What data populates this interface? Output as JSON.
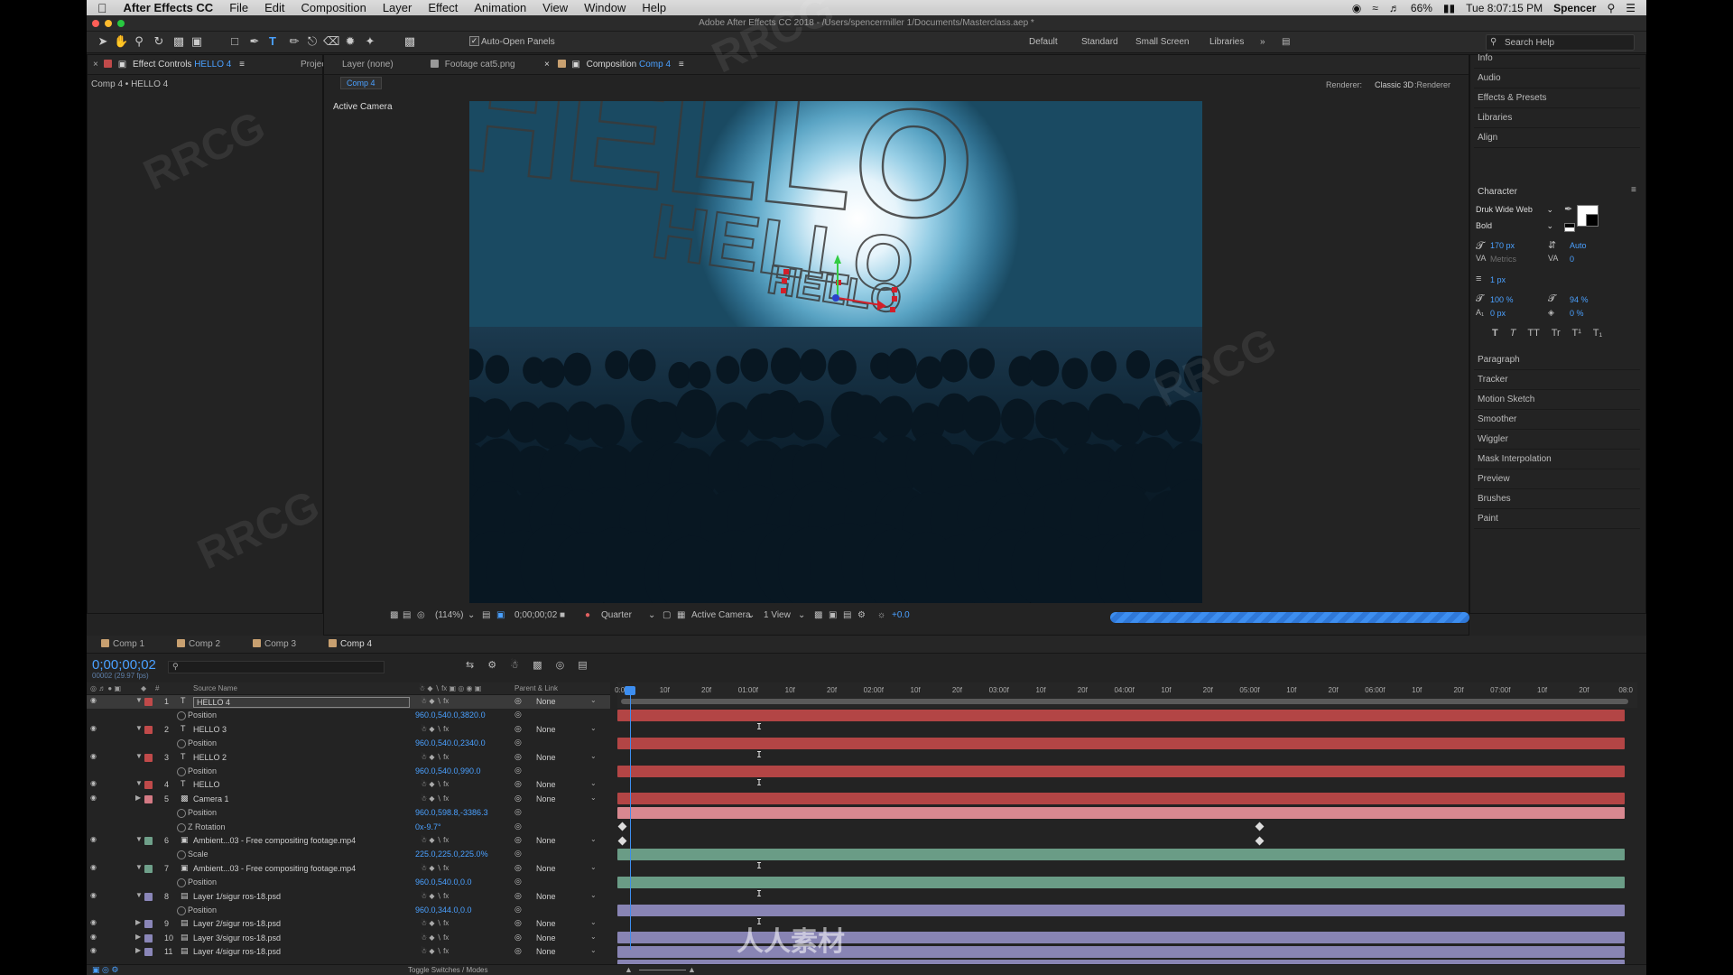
{
  "menubar": {
    "app_name": "After Effects CC",
    "items": [
      "File",
      "Edit",
      "Composition",
      "Layer",
      "Effect",
      "Animation",
      "View",
      "Window",
      "Help"
    ],
    "battery": "66%",
    "clock": "Tue 8:07:15 PM",
    "user": "Spencer"
  },
  "window": {
    "title": "Adobe After Effects CC 2018 - /Users/spencermiller 1/Documents/Masterclass.aep *"
  },
  "toolbar": {
    "auto_open_panels": "Auto-Open Panels",
    "workspaces": [
      "Default",
      "Standard",
      "Small Screen",
      "Libraries"
    ],
    "search_help": "Search Help"
  },
  "left_panel": {
    "tabs": {
      "effect_controls": "Effect Controls",
      "effect_controls_layer": "HELLO 4",
      "project": "Project"
    },
    "breadcrumb": "Comp 4 • HELLO 4"
  },
  "viewer": {
    "tabs": {
      "layer": "Layer (none)",
      "footage": "Footage cat5.png",
      "composition": "Composition",
      "composition_name": "Comp 4"
    },
    "sub_tab": "Comp 4",
    "renderer_label": "Renderer:",
    "renderer_value": "Classic 3D",
    "active_camera_label": "Active Camera",
    "scene_text": "HELLO"
  },
  "viewer_controls": {
    "zoom": "(114%)",
    "timecode": "0;00;00;02",
    "resolution": "Quarter",
    "camera": "Active Camera",
    "views": "1 View",
    "exposure": "+0.0"
  },
  "right_panel": {
    "items_top": [
      "Info",
      "Audio",
      "Effects & Presets",
      "Libraries",
      "Align"
    ],
    "character": {
      "title": "Character",
      "font": "Druk Wide Web",
      "style": "Bold",
      "size": "170 px",
      "leading": "Auto",
      "kerning": "Metrics",
      "tracking": "0",
      "stroke_width": "1 px",
      "vert_scale": "100 %",
      "horiz_scale": "94 %",
      "baseline": "0 px",
      "tsume": "0 %",
      "styles": [
        "T",
        "T",
        "TT",
        "Tr",
        "T¹",
        "T₁"
      ]
    },
    "items_bottom": [
      "Paragraph",
      "Tracker",
      "Motion Sketch",
      "Smoother",
      "Wiggler",
      "Mask Interpolation",
      "Preview",
      "Brushes",
      "Paint"
    ]
  },
  "timeline": {
    "tabs": [
      "Comp 1",
      "Comp 2",
      "Comp 3",
      "Comp 4"
    ],
    "current_time": "0;00;00;02",
    "frame_info": "00002 (29.97 fps)",
    "col_source_name": "Source Name",
    "col_parent": "Parent & Link",
    "ruler_labels": [
      "0:00f",
      "10f",
      "20f",
      "01:00f",
      "10f",
      "20f",
      "02:00f",
      "10f",
      "20f",
      "03:00f",
      "10f",
      "20f",
      "04:00f",
      "10f",
      "20f",
      "05:00f",
      "10f",
      "20f",
      "06:00f",
      "10f",
      "20f",
      "07:00f",
      "10f",
      "20f",
      "08:0"
    ],
    "rows": [
      {
        "kind": "layer",
        "num": "1",
        "type": "T",
        "name": "HELLO 4",
        "parent": "None",
        "label": "#c04a4a",
        "selected": true
      },
      {
        "kind": "prop",
        "name": "Position",
        "value": "960.0,540.0,3820.0"
      },
      {
        "kind": "layer",
        "num": "2",
        "type": "T",
        "name": "HELLO 3",
        "parent": "None",
        "label": "#c04a4a"
      },
      {
        "kind": "prop",
        "name": "Position",
        "value": "960.0,540.0,2340.0"
      },
      {
        "kind": "layer",
        "num": "3",
        "type": "T",
        "name": "HELLO 2",
        "parent": "None",
        "label": "#c04a4a"
      },
      {
        "kind": "prop",
        "name": "Position",
        "value": "960.0,540.0,990.0"
      },
      {
        "kind": "layer",
        "num": "4",
        "type": "T",
        "name": "HELLO",
        "parent": "None",
        "label": "#c04a4a"
      },
      {
        "kind": "layer",
        "num": "5",
        "type": "cam",
        "name": "Camera 1",
        "parent": "None",
        "label": "#d47a84"
      },
      {
        "kind": "prop",
        "name": "Position",
        "value": "960.0,598.8,-3386.3"
      },
      {
        "kind": "prop",
        "name": "Z Rotation",
        "value": "0x-9.7°"
      },
      {
        "kind": "layer",
        "num": "6",
        "type": "vid",
        "name": "Ambient...03 - Free compositing footage.mp4",
        "parent": "None",
        "label": "#6fa08a"
      },
      {
        "kind": "prop",
        "name": "Scale",
        "value": "225.0,225.0,225.0%"
      },
      {
        "kind": "layer",
        "num": "7",
        "type": "vid",
        "name": "Ambient...03 - Free compositing footage.mp4",
        "parent": "None",
        "label": "#6fa08a"
      },
      {
        "kind": "prop",
        "name": "Position",
        "value": "960.0,540.0,0.0"
      },
      {
        "kind": "layer",
        "num": "8",
        "type": "psd",
        "name": "Layer 1/sigur ros-18.psd",
        "parent": "None",
        "label": "#8a86b8"
      },
      {
        "kind": "prop",
        "name": "Position",
        "value": "960.0,344.0,0.0"
      },
      {
        "kind": "layer",
        "num": "9",
        "type": "psd",
        "name": "Layer 2/sigur ros-18.psd",
        "parent": "None",
        "label": "#8a86b8"
      },
      {
        "kind": "layer",
        "num": "10",
        "type": "psd",
        "name": "Layer 3/sigur ros-18.psd",
        "parent": "None",
        "label": "#8a86b8"
      },
      {
        "kind": "layer",
        "num": "11",
        "type": "psd",
        "name": "Layer 4/sigur ros-18.psd",
        "parent": "None",
        "label": "#8a86b8"
      }
    ],
    "toggle_label": "Toggle Switches / Modes"
  },
  "watermark": {
    "text": "RRCG",
    "text2": "人人素材"
  }
}
